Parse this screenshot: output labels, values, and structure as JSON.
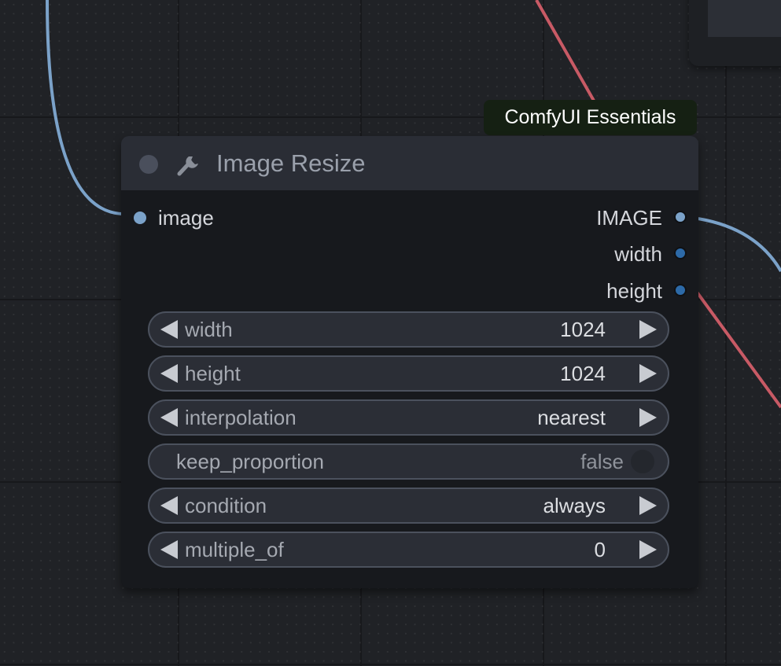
{
  "badge": {
    "text": "ComfyUI Essentials"
  },
  "node": {
    "title": "Image Resize",
    "title_icon": "wrench-icon",
    "inputs": [
      {
        "label": "image",
        "color": "#7ba2c9"
      }
    ],
    "outputs": [
      {
        "label": "IMAGE",
        "color": "#7ba2c9"
      },
      {
        "label": "width",
        "color": "#2d6aa8"
      },
      {
        "label": "height",
        "color": "#2d6aa8"
      }
    ],
    "widgets": {
      "width": {
        "label": "width",
        "value": "1024"
      },
      "height": {
        "label": "height",
        "value": "1024"
      },
      "interpolation": {
        "label": "interpolation",
        "value": "nearest"
      },
      "keep_proportion": {
        "label": "keep_proportion",
        "value": "false"
      },
      "condition": {
        "label": "condition",
        "value": "always"
      },
      "multiple_of": {
        "label": "multiple_of",
        "value": "0"
      }
    }
  },
  "colors": {
    "image_link": "#7ba2c9",
    "int_link": "#c85a65",
    "node_body": "#17191d",
    "node_header": "#2a2d35",
    "badge_bg": "#152013"
  }
}
